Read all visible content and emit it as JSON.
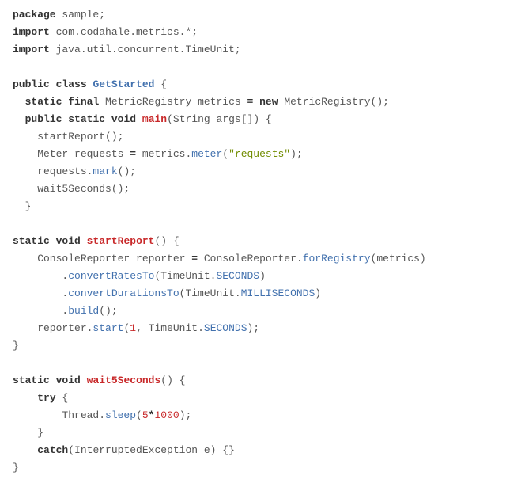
{
  "code": {
    "l1_package": "package",
    "l1_pkgname": " sample;",
    "l2_import": "import",
    "l2_rest": " com.codahale.metrics.*;",
    "l3_import": "import",
    "l3_rest": " java.util.concurrent.TimeUnit;",
    "l5_public": "public",
    "l5_class": "class",
    "l5_name": "GetStarted",
    "l5_brace": " {",
    "l6_pre": "  ",
    "l6_static": "static",
    "l6_final": "final",
    "l6_rest1": " MetricRegistry metrics ",
    "l6_eq": "=",
    "l6_new": "new",
    "l6_rest2": " MetricRegistry();",
    "l7_pre": "  ",
    "l7_public": "public",
    "l7_static": "static",
    "l7_void": "void",
    "l7_main": "main",
    "l7_rest": "(String args[]) {",
    "l8": "    startReport();",
    "l9a": "    Meter requests ",
    "l9eq": "=",
    "l9b": " metrics.",
    "l9c": "meter",
    "l9d": "(",
    "l9str": "\"requests\"",
    "l9e": ");",
    "l10a": "    requests.",
    "l10b": "mark",
    "l10c": "();",
    "l11": "    wait5Seconds();",
    "l12": "  }",
    "l14_static": "static",
    "l14_void": "void",
    "l14_name": "startReport",
    "l14_rest": "() {",
    "l15a": "    ConsoleReporter reporter ",
    "l15eq": "=",
    "l15b": " ConsoleReporter.",
    "l15c": "forRegistry",
    "l15d": "(metrics)",
    "l16a": "        .",
    "l16b": "convertRatesTo",
    "l16c": "(TimeUnit.",
    "l16d": "SECONDS",
    "l16e": ")",
    "l17a": "        .",
    "l17b": "convertDurationsTo",
    "l17c": "(TimeUnit.",
    "l17d": "MILLISECONDS",
    "l17e": ")",
    "l18a": "        .",
    "l18b": "build",
    "l18c": "();",
    "l19a": "    reporter.",
    "l19b": "start",
    "l19c": "(",
    "l19n": "1",
    "l19d": ", TimeUnit.",
    "l19e": "SECONDS",
    "l19f": ");",
    "l20": "}",
    "l22_static": "static",
    "l22_void": "void",
    "l22_name": "wait5Seconds",
    "l22_rest": "() {",
    "l23_pre": "    ",
    "l23_try": "try",
    "l23_rest": " {",
    "l24a": "        Thread.",
    "l24b": "sleep",
    "l24c": "(",
    "l24n1": "5",
    "l24op": "*",
    "l24n2": "1000",
    "l24d": ");",
    "l25": "    }",
    "l26_pre": "    ",
    "l26_catch": "catch",
    "l26_rest": "(InterruptedException e) {}",
    "l27": "}"
  }
}
